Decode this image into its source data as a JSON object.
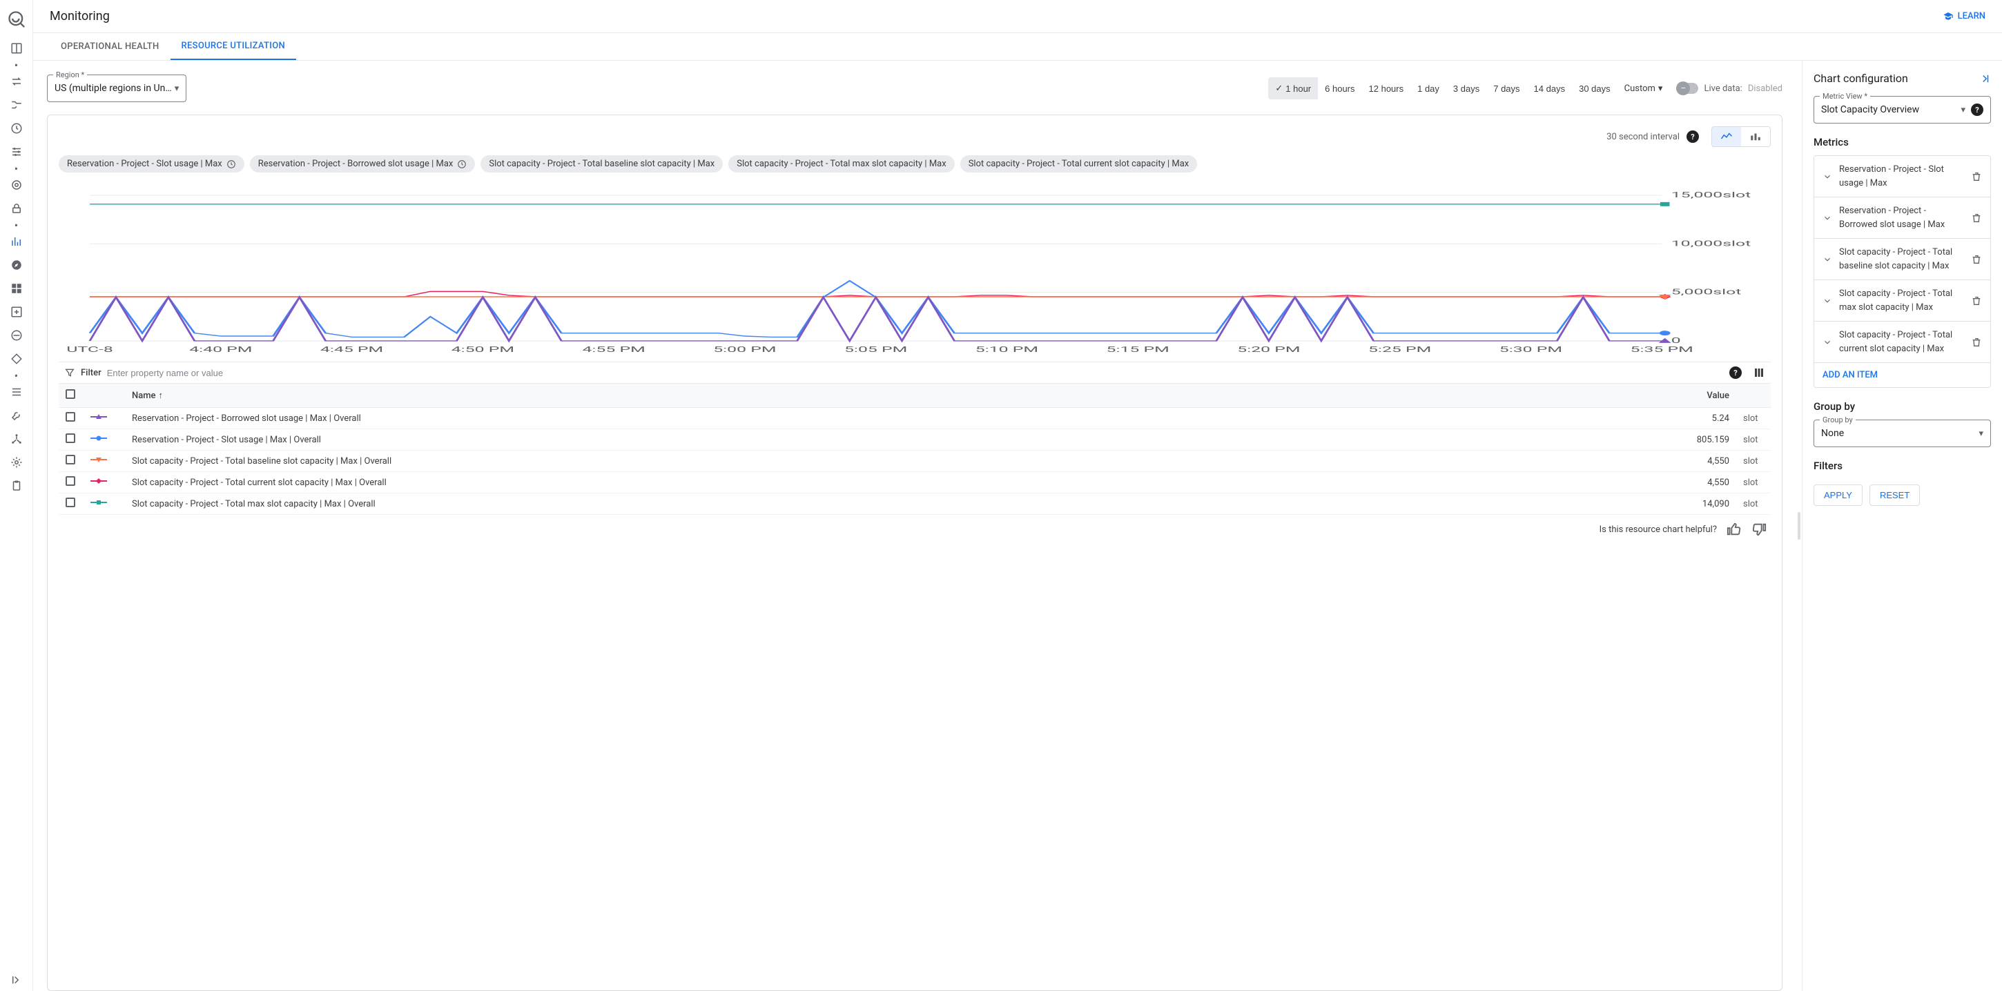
{
  "header": {
    "title": "Monitoring",
    "learn": "LEARN"
  },
  "tabs": {
    "operational": "OPERATIONAL HEALTH",
    "resource": "RESOURCE UTILIZATION"
  },
  "region": {
    "label": "Region *",
    "value": "US (multiple regions in Un…"
  },
  "time_ranges": [
    "1 hour",
    "6 hours",
    "12 hours",
    "1 day",
    "3 days",
    "7 days",
    "14 days",
    "30 days"
  ],
  "time_selected": "1 hour",
  "custom_label": "Custom",
  "live_data": {
    "label": "Live data:",
    "state": "Disabled"
  },
  "card": {
    "interval": "30 second interval",
    "chips": [
      {
        "label": "Reservation - Project - Slot usage | Max",
        "icon": "clock"
      },
      {
        "label": "Reservation - Project - Borrowed slot usage | Max",
        "icon": "clock"
      },
      {
        "label": "Slot capacity - Project - Total baseline slot capacity | Max",
        "icon": null
      },
      {
        "label": "Slot capacity - Project - Total max slot capacity | Max",
        "icon": null
      },
      {
        "label": "Slot capacity - Project - Total current slot capacity | Max",
        "icon": null
      }
    ]
  },
  "chart_data": {
    "type": "line",
    "x_labels": [
      "UTC-8",
      "4:40 PM",
      "4:45 PM",
      "4:50 PM",
      "4:55 PM",
      "5:00 PM",
      "5:05 PM",
      "5:10 PM",
      "5:15 PM",
      "5:20 PM",
      "5:25 PM",
      "5:30 PM",
      "5:35 PM"
    ],
    "y_ticks": [
      {
        "v": 0,
        "label": "0"
      },
      {
        "v": 5000,
        "label": "5,000slot"
      },
      {
        "v": 10000,
        "label": "10,000slot"
      },
      {
        "v": 15000,
        "label": "15,000slot"
      }
    ],
    "ylim": [
      0,
      15500
    ],
    "series": [
      {
        "name": "Total max slot capacity",
        "color": "#26a69a",
        "marker": "square",
        "values": [
          14090,
          14090,
          14090,
          14090,
          14090,
          14090,
          14090,
          14090,
          14090,
          14090,
          14090,
          14090,
          14090,
          14090,
          14090,
          14090,
          14090,
          14090,
          14090,
          14090,
          14090,
          14090,
          14090,
          14090,
          14090,
          14090,
          14090,
          14090,
          14090,
          14090,
          14090,
          14090,
          14090,
          14090,
          14090,
          14090,
          14090,
          14090,
          14090,
          14090,
          14090,
          14090,
          14090,
          14090,
          14090,
          14090,
          14090,
          14090,
          14090,
          14090,
          14090,
          14090,
          14090,
          14090,
          14090,
          14090,
          14090,
          14090,
          14090,
          14090,
          14090
        ]
      },
      {
        "name": "Total current slot capacity",
        "color": "#e91e63",
        "marker": "diamond",
        "values": [
          4550,
          4550,
          4550,
          4550,
          4550,
          4550,
          4550,
          4550,
          4550,
          4550,
          4550,
          4550,
          4550,
          5100,
          5100,
          5100,
          4700,
          4550,
          4550,
          4550,
          4550,
          4550,
          4550,
          4550,
          4550,
          4550,
          4550,
          4550,
          4550,
          4700,
          4550,
          4550,
          4550,
          4550,
          4700,
          4700,
          4550,
          4550,
          4550,
          4550,
          4550,
          4550,
          4550,
          4550,
          4550,
          4700,
          4550,
          4550,
          4700,
          4550,
          4550,
          4550,
          4550,
          4550,
          4550,
          4550,
          4550,
          4700,
          4550,
          4550,
          4550
        ]
      },
      {
        "name": "Total baseline slot capacity",
        "color": "#ff7043",
        "marker": "triangle-down",
        "values": [
          4550,
          4550,
          4550,
          4550,
          4550,
          4550,
          4550,
          4550,
          4550,
          4550,
          4550,
          4550,
          4550,
          4550,
          4550,
          4550,
          4550,
          4550,
          4550,
          4550,
          4550,
          4550,
          4550,
          4550,
          4550,
          4550,
          4550,
          4550,
          4550,
          4550,
          4550,
          4550,
          4550,
          4550,
          4550,
          4550,
          4550,
          4550,
          4550,
          4550,
          4550,
          4550,
          4550,
          4550,
          4550,
          4550,
          4550,
          4550,
          4550,
          4550,
          4550,
          4550,
          4550,
          4550,
          4550,
          4550,
          4550,
          4550,
          4550,
          4550,
          4550
        ]
      },
      {
        "name": "Slot usage",
        "color": "#4285f4",
        "marker": "circle",
        "values": [
          805,
          4500,
          805,
          4500,
          805,
          500,
          500,
          500,
          4500,
          805,
          400,
          400,
          400,
          2500,
          805,
          4500,
          805,
          4500,
          805,
          805,
          805,
          805,
          805,
          805,
          805,
          500,
          400,
          400,
          4500,
          6200,
          4500,
          805,
          4500,
          805,
          805,
          805,
          805,
          805,
          805,
          805,
          805,
          805,
          805,
          805,
          4500,
          805,
          4500,
          805,
          4500,
          805,
          805,
          805,
          805,
          805,
          805,
          805,
          805,
          4500,
          805,
          805,
          805
        ]
      },
      {
        "name": "Borrowed slot usage",
        "color": "#7e57c2",
        "marker": "triangle-up",
        "values": [
          5,
          4500,
          5,
          4500,
          5,
          5,
          5,
          5,
          4500,
          5,
          5,
          5,
          5,
          5,
          5,
          4500,
          5,
          4500,
          5,
          5,
          5,
          5,
          5,
          5,
          5,
          5,
          5,
          5,
          4500,
          5,
          4500,
          5,
          4500,
          5,
          5,
          5,
          5,
          5,
          5,
          5,
          5,
          5,
          5,
          5,
          4500,
          5,
          4500,
          5,
          4500,
          5,
          5,
          5,
          5,
          5,
          5,
          5,
          5,
          4500,
          5,
          5,
          5
        ]
      }
    ]
  },
  "filter": {
    "label": "Filter",
    "placeholder": "Enter property name or value"
  },
  "table": {
    "headers": {
      "name": "Name",
      "value": "Value"
    },
    "unit": "slot",
    "rows": [
      {
        "color": "#7e57c2",
        "marker": "triangle-up",
        "name": "Reservation - Project - Borrowed slot usage | Max | Overall",
        "value": "5.24"
      },
      {
        "color": "#4285f4",
        "marker": "circle",
        "name": "Reservation - Project - Slot usage | Max | Overall",
        "value": "805.159"
      },
      {
        "color": "#ff7043",
        "marker": "triangle-down",
        "name": "Slot capacity - Project - Total baseline slot capacity | Max | Overall",
        "value": "4,550"
      },
      {
        "color": "#e91e63",
        "marker": "diamond",
        "name": "Slot capacity - Project - Total current slot capacity | Max | Overall",
        "value": "4,550"
      },
      {
        "color": "#26a69a",
        "marker": "square",
        "name": "Slot capacity - Project - Total max slot capacity | Max | Overall",
        "value": "14,090"
      }
    ]
  },
  "feedback": {
    "question": "Is this resource chart helpful?"
  },
  "panel": {
    "title": "Chart configuration",
    "metric_view": {
      "label": "Metric View *",
      "value": "Slot Capacity Overview"
    },
    "metrics_title": "Metrics",
    "metrics": [
      "Reservation - Project - Slot usage | Max",
      "Reservation - Project - Borrowed slot usage | Max",
      "Slot capacity - Project - Total baseline slot capacity | Max",
      "Slot capacity - Project - Total max slot capacity | Max",
      "Slot capacity - Project - Total current slot capacity | Max"
    ],
    "add_item": "ADD AN ITEM",
    "group_by_title": "Group by",
    "group_by": {
      "label": "Group by",
      "value": "None"
    },
    "filters_title": "Filters",
    "apply": "APPLY",
    "reset": "RESET"
  }
}
